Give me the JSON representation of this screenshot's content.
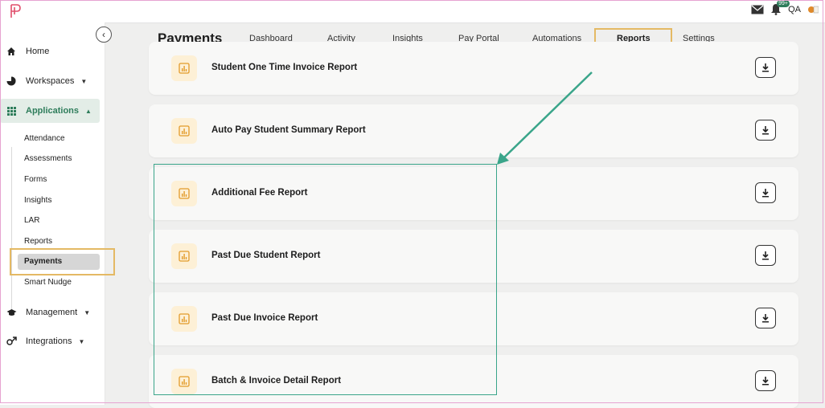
{
  "topbar": {
    "user_initials": "QA",
    "notification_count": "99+"
  },
  "sidebar": {
    "collapse_icon": "chevron-left-icon",
    "items": [
      {
        "label": "Home",
        "icon": "home-icon"
      },
      {
        "label": "Workspaces",
        "icon": "pie-chart-icon"
      },
      {
        "label": "Applications",
        "icon": "grid-icon"
      },
      {
        "label": "Management",
        "icon": "graduation-cap-icon"
      },
      {
        "label": "Integrations",
        "icon": "integrations-icon"
      }
    ],
    "sub_items": [
      "Attendance",
      "Assessments",
      "Forms",
      "Insights",
      "LAR",
      "Reports",
      "Payments",
      "Smart Nudge"
    ],
    "selected_sub": "Payments"
  },
  "header": {
    "title": "Payments",
    "tabs": [
      "Dashboard",
      "Activity",
      "Insights",
      "Pay Portal",
      "Automations",
      "Reports",
      "Settings"
    ],
    "active_tab": "Reports"
  },
  "reports": [
    "Student One Time Invoice Report",
    "Auto Pay Student Summary Report",
    "Additional Fee Report",
    "Past Due Student Report",
    "Past Due Invoice Report",
    "Batch & Invoice Detail Report"
  ],
  "colors": {
    "accent": "#2e7d5b",
    "highlight": "#e4b964",
    "annotation": "#3aa58a",
    "report_icon_bg": "#fdf0d6",
    "report_icon": "#e39b2a"
  }
}
